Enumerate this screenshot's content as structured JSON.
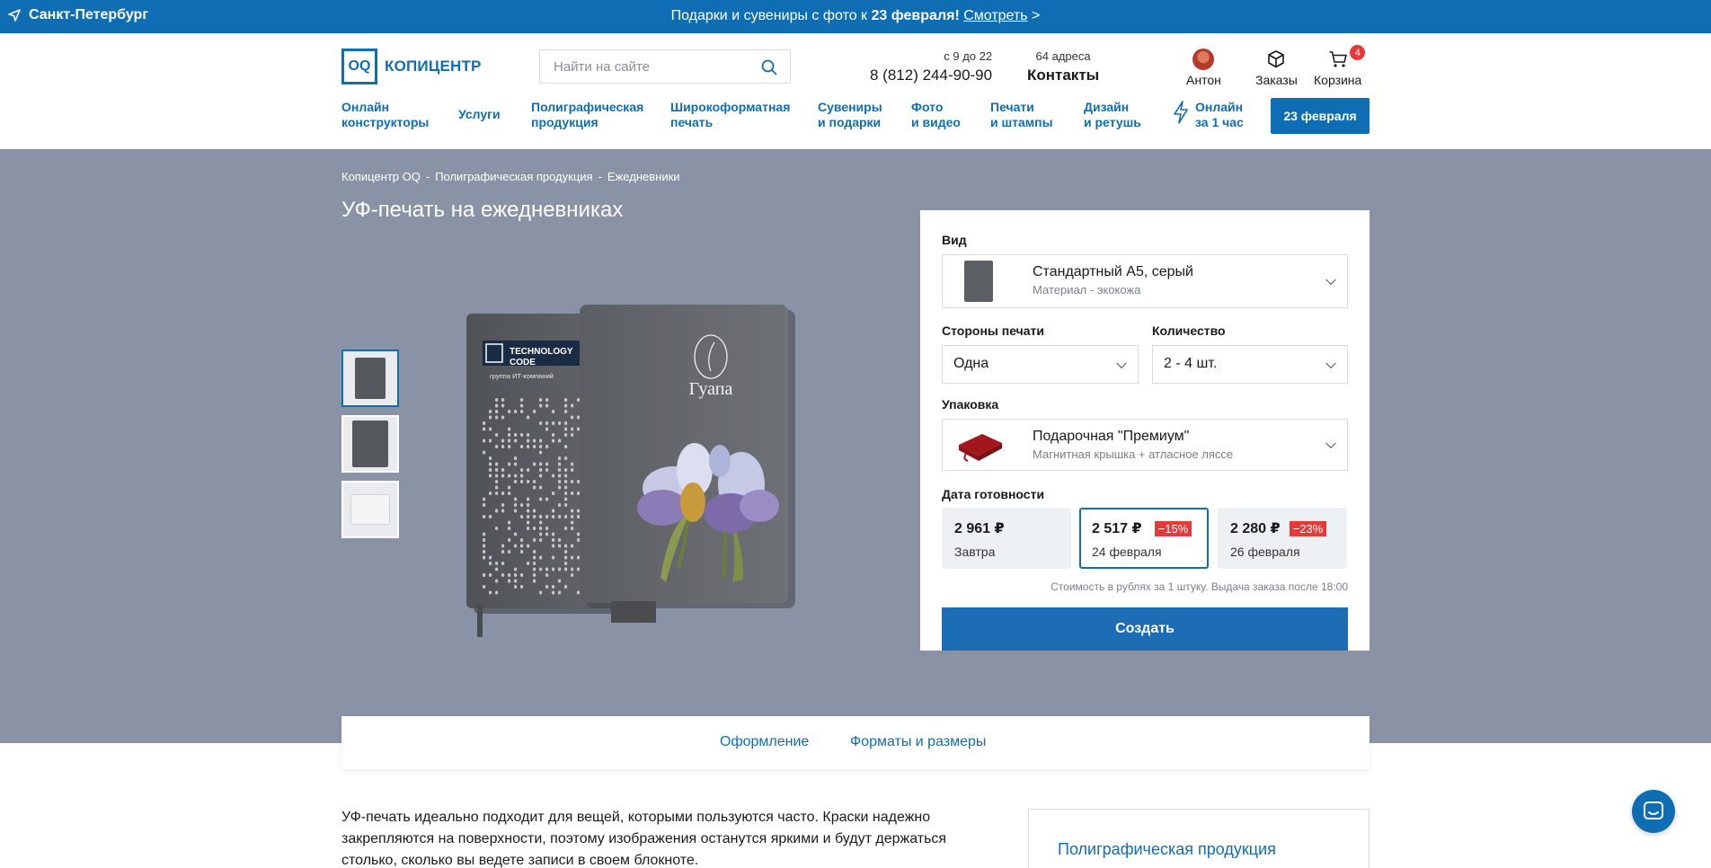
{
  "topbar": {
    "city": "Санкт-Петербург",
    "promo_text": "Подарки и сувениры с фото к ",
    "promo_bold": "23 февраля!",
    "promo_link": "Смотреть",
    "promo_arrow": ">"
  },
  "header": {
    "logo_mark": "OQ",
    "logo_name": "КОПИЦЕНТР",
    "search_placeholder": "Найти на сайте",
    "hours": "с 9 до 22",
    "phone": "8 (812) 244-90-90",
    "addresses": "64 адреса",
    "contacts": "Контакты",
    "user": "Антон",
    "orders": "Заказы",
    "cart": "Корзина",
    "cart_count": "4"
  },
  "nav": {
    "items": [
      {
        "line1": "Онлайн",
        "line2": "конструкторы"
      },
      {
        "line1": "Услуги",
        "line2": ""
      },
      {
        "line1": "Полиграфическая",
        "line2": "продукция"
      },
      {
        "line1": "Широкоформатная",
        "line2": "печать"
      },
      {
        "line1": "Сувениры",
        "line2": "и подарки"
      },
      {
        "line1": "Фото",
        "line2": "и видео"
      },
      {
        "line1": "Печати",
        "line2": "и штампы"
      },
      {
        "line1": "Дизайн",
        "line2": "и ретушь"
      },
      {
        "line1": "Онлайн",
        "line2": "за 1 час"
      }
    ],
    "cta": "23 февраля"
  },
  "breadcrumbs": [
    "Копицентр OQ",
    "-",
    "Полиграфическая продукция",
    "-",
    "Ежедневники"
  ],
  "page_title": "УФ-печать на ежедневниках",
  "product_image": {
    "left_book_title": "TECHNOLOGY",
    "left_book_title2": "CODE",
    "left_book_sub": "группа ИТ-компаний",
    "right_book_brand": "Гуапа"
  },
  "config": {
    "type_label": "Вид",
    "type_value": "Стандартный А5, серый",
    "type_sub": "Материал - экокожа",
    "sides_label": "Стороны печати",
    "sides_value": "Одна",
    "qty_label": "Количество",
    "qty_value": "2 - 4 шт.",
    "pack_label": "Упаковка",
    "pack_value": "Подарочная \"Премиум\"",
    "pack_sub": "Магнитная крышка + атласное ляссе",
    "date_label": "Дата готовности",
    "prices": [
      {
        "price": "2 961 ₽",
        "discount": "",
        "date": "Завтра",
        "selected": false
      },
      {
        "price": "2 517 ₽",
        "discount": "−15%",
        "date": "24 февраля",
        "selected": true
      },
      {
        "price": "2 280 ₽",
        "discount": "−23%",
        "date": "26 февраля",
        "selected": false
      }
    ],
    "note": "Стоимость в рублях за 1 штуку. Выдача заказа после 18:00",
    "create": "Создать"
  },
  "tabs": [
    "Оформление",
    "Форматы и размеры"
  ],
  "description": "УФ-печать идеально подходит для вещей, которыми пользуются часто. Краски надежно закрепляются на поверхности, поэтому изображения останутся яркими и будут держаться столько, сколько вы ведете записи в своем блокноте.",
  "sidebar_link": "Полиграфическая продукция",
  "colors": {
    "brand": "#0f6eb3",
    "hero_bg": "#8a93a6",
    "discount": "#e63939"
  }
}
